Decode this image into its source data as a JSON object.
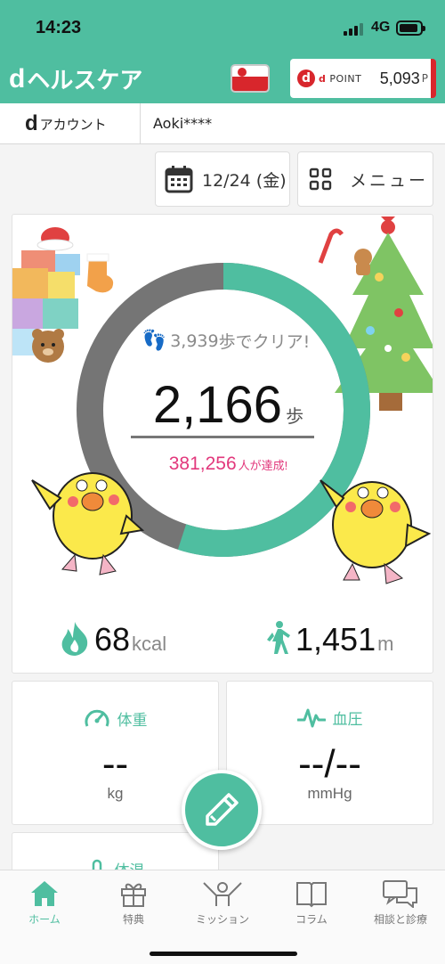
{
  "status_bar": {
    "time": "14:23",
    "network": "4G"
  },
  "header": {
    "app_title": "ヘルスケア",
    "dpoint_label": "POINT",
    "dpoint_value": "5,093",
    "dpoint_unit": "P"
  },
  "account": {
    "label": "アカウント",
    "user": "Aoki****"
  },
  "date_button": {
    "label": "12/24 (金)"
  },
  "menu_button": {
    "label": "メニュー"
  },
  "steps": {
    "goal_text": "3,939",
    "goal_suffix": "歩でクリア!",
    "current": "2,166",
    "unit": "歩",
    "achievers": "381,256",
    "achievers_suffix": "人が達成!",
    "progress_fraction": 0.55
  },
  "calories": {
    "value": "68",
    "unit": "kcal"
  },
  "distance": {
    "value": "1,451",
    "unit": "m"
  },
  "weight_card": {
    "title": "体重",
    "value": "--",
    "unit": "kg"
  },
  "bp_card": {
    "title": "血圧",
    "value": "--/--",
    "unit": "mmHg"
  },
  "temp_card": {
    "title": "体温"
  },
  "tabs": [
    {
      "label": "ホーム",
      "icon": "home-icon"
    },
    {
      "label": "特典",
      "icon": "gift-icon"
    },
    {
      "label": "ミッション",
      "icon": "mission-icon"
    },
    {
      "label": "コラム",
      "icon": "book-icon"
    },
    {
      "label": "相談と診療",
      "icon": "chat-icon"
    }
  ],
  "colors": {
    "accent": "#4fbea0",
    "ring_track": "#757575",
    "pink": "#e2387c",
    "brand_red": "#d8262c"
  }
}
